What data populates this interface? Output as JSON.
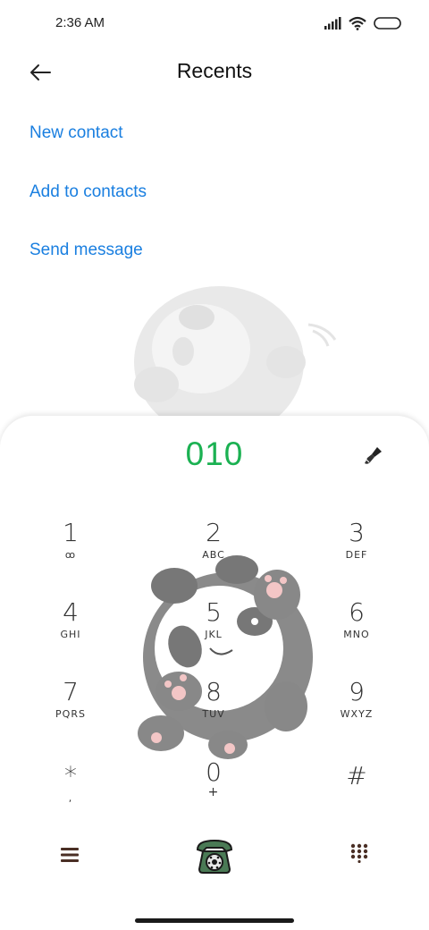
{
  "status_bar": {
    "time": "2:36 AM",
    "icons": [
      "signal-icon",
      "wifi-icon",
      "battery-icon"
    ]
  },
  "header": {
    "title": "Recents",
    "back_icon": "arrow-left-icon"
  },
  "actions": {
    "new_contact": "New contact",
    "add_to_contacts": "Add to contacts",
    "send_message": "Send message"
  },
  "dialer": {
    "number": "010",
    "theme_icon": "brush-icon",
    "keys": [
      {
        "digit": "1",
        "letters": "ꝏ"
      },
      {
        "digit": "2",
        "letters": "ABC"
      },
      {
        "digit": "3",
        "letters": "DEF"
      },
      {
        "digit": "4",
        "letters": "GHI"
      },
      {
        "digit": "5",
        "letters": "JKL"
      },
      {
        "digit": "6",
        "letters": "MNO"
      },
      {
        "digit": "7",
        "letters": "PQRS"
      },
      {
        "digit": "8",
        "letters": "TUV"
      },
      {
        "digit": "9",
        "letters": "WXYZ"
      },
      {
        "digit": "*",
        "letters": ","
      },
      {
        "digit": "0",
        "letters": "+"
      },
      {
        "digit": "#",
        "letters": ""
      }
    ],
    "bottom_icons": [
      "menu-icon",
      "phone-call-icon",
      "keypad-icon"
    ]
  },
  "colors": {
    "accent_link": "#1a7fe0",
    "number_green": "#1bb152",
    "dial_button_green": "#4a7a55"
  }
}
